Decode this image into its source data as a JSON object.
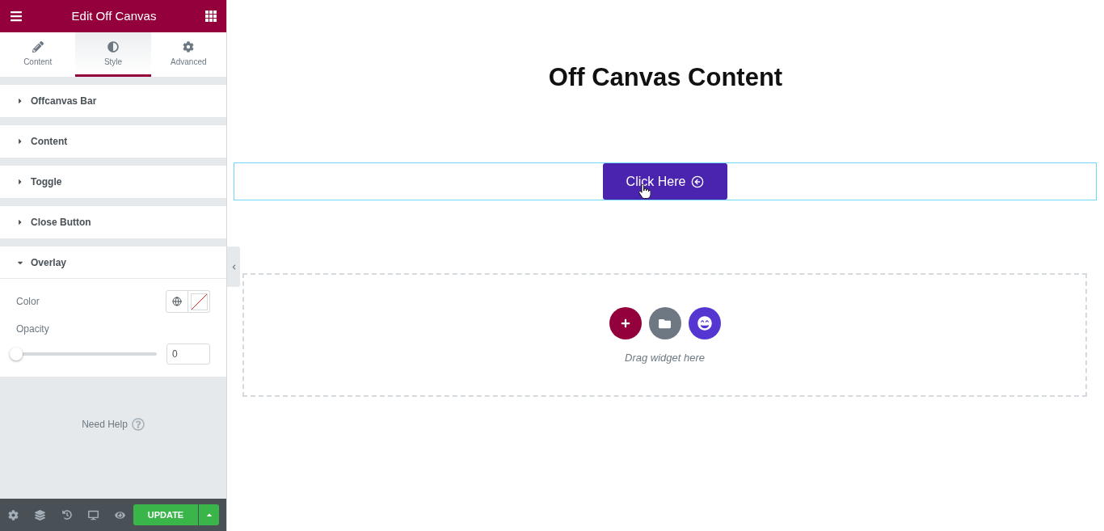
{
  "header": {
    "title": "Edit Off Canvas"
  },
  "tabs": [
    {
      "label": "Content",
      "selected": false
    },
    {
      "label": "Style",
      "selected": true
    },
    {
      "label": "Advanced",
      "selected": false
    }
  ],
  "sections": [
    {
      "title": "Offcanvas Bar",
      "expanded": false
    },
    {
      "title": "Content",
      "expanded": false
    },
    {
      "title": "Toggle",
      "expanded": false
    },
    {
      "title": "Close Button",
      "expanded": false
    },
    {
      "title": "Overlay",
      "expanded": true,
      "controls": [
        {
          "kind": "color",
          "label": "Color"
        },
        {
          "kind": "slider",
          "label": "Opacity",
          "level": 0,
          "value": "0"
        }
      ]
    }
  ],
  "help": {
    "label": "Need Help"
  },
  "footer": {
    "update_label": "UPDATE"
  },
  "canvas": {
    "heading": "Off Canvas Content",
    "button_label": "Click Here",
    "dropzone_hint": "Drag widget here"
  }
}
